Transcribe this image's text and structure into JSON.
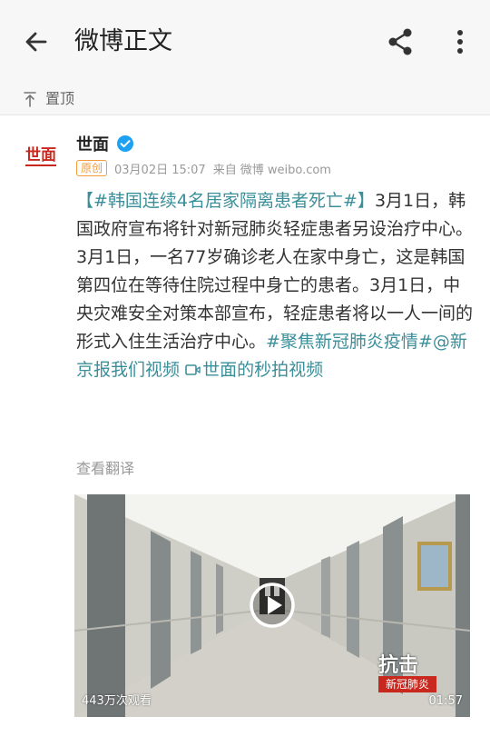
{
  "header": {
    "title": "微博正文"
  },
  "pin": {
    "label": "置顶"
  },
  "post": {
    "author": "世面",
    "badge": "原创",
    "time": "03月02日 15:07",
    "source_prefix": "来自",
    "source": "微博 weibo.com",
    "content": {
      "topic": "【#韩国连续4名居家隔离患者死亡#】",
      "body": "3月1日，韩国政府宣布将针对新冠肺炎轻症患者另设治疗中心。3月1日，一名77岁确诊老人在家中身亡，这是韩国第四位在等待住院过程中身亡的患者。3月1日，中央灾难安全对策本部宣布，轻症患者将以一人一间的形式入住生活治疗中心。",
      "tag2": "#聚焦新冠肺炎疫情#",
      "mention": "@新京报我们视频",
      "video_link": "世面的秒拍视频"
    },
    "translate": "查看翻译",
    "video": {
      "views": "443万次观看",
      "duration": "01:57",
      "watermark_top": "抗击",
      "watermark_bottom": "新冠肺炎"
    }
  },
  "avatar_text": "世面",
  "colors": {
    "link": "#3a8f9a",
    "badge": "#f29c3a",
    "verify": "#1da1f2"
  }
}
